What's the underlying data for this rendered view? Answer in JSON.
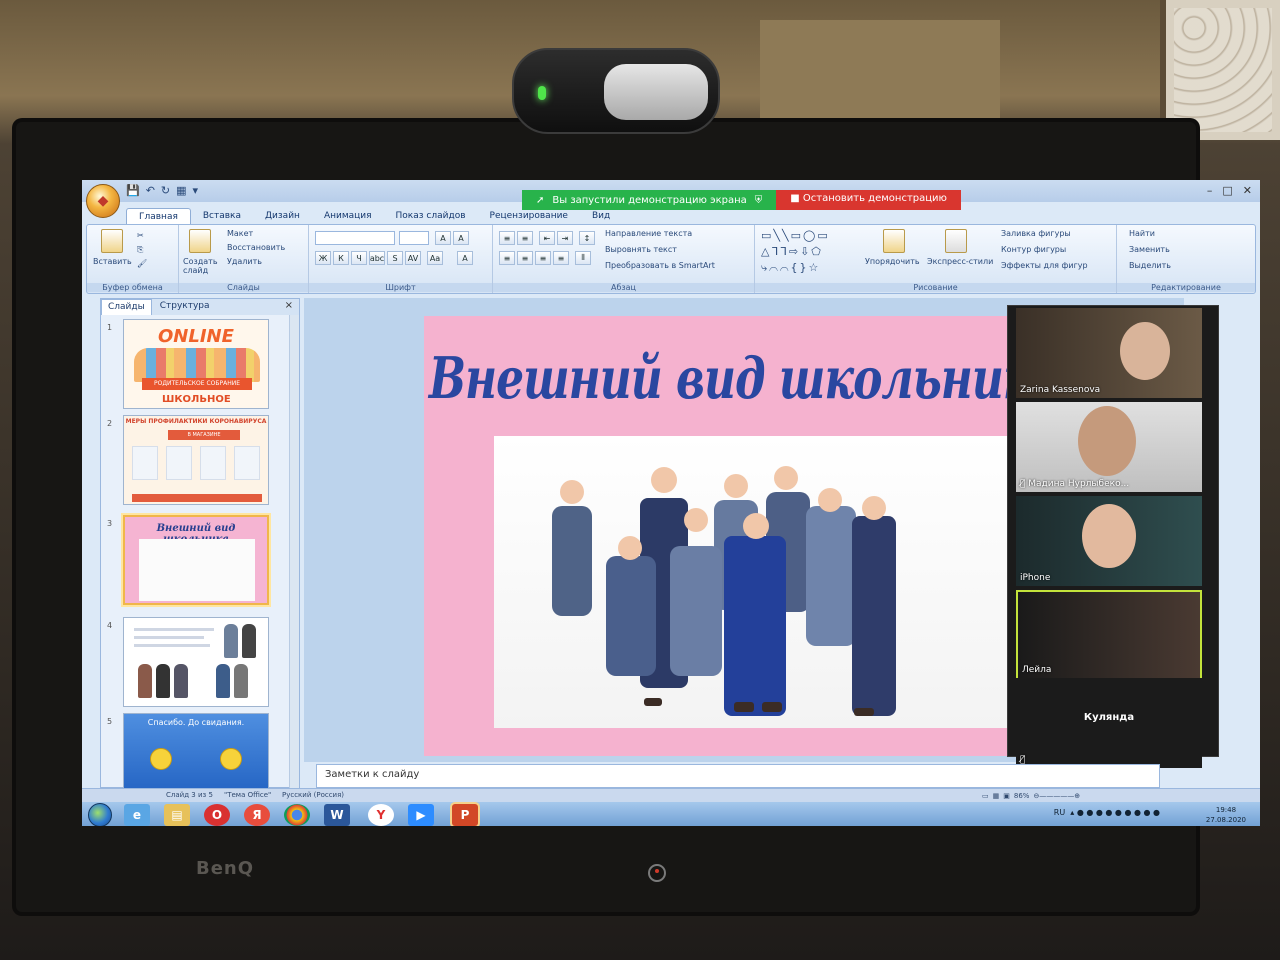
{
  "window": {
    "quick_access": [
      "💾",
      "↶",
      "↻",
      "▦",
      "▾"
    ],
    "controls": [
      "–",
      "□",
      "✕"
    ]
  },
  "share_bar": {
    "status": "Вы запустили демонстрацию экрана",
    "stop": "Остановить демонстрацию"
  },
  "ribbon": {
    "tabs": [
      "Главная",
      "Вставка",
      "Дизайн",
      "Анимация",
      "Показ слайдов",
      "Рецензирование",
      "Вид"
    ],
    "active_tab": "Главная",
    "clipboard": {
      "paste": "Вставить",
      "label": "Буфер обмена"
    },
    "slides": {
      "create": "Создать слайд",
      "layout": "Макет",
      "reset": "Восстановить",
      "delete": "Удалить",
      "label": "Слайды"
    },
    "font": {
      "label": "Шрифт",
      "bold": "Ж",
      "italic": "К",
      "underline": "Ч",
      "strike": "abc",
      "shadow": "S",
      "spacing": "AV",
      "case": "Aa",
      "grow": "A",
      "shrink": "A",
      "color": "A"
    },
    "paragraph": {
      "label": "Абзац",
      "direction": "Направление текста",
      "align": "Выровнять текст",
      "smartart": "Преобразовать в SmartArt"
    },
    "drawing": {
      "label": "Рисование",
      "arrange": "Упорядочить",
      "quick_styles": "Экспресс-стили",
      "fill": "Заливка фигуры",
      "outline": "Контур фигуры",
      "effects": "Эффекты для фигур"
    },
    "editing": {
      "label": "Редактирование",
      "find": "Найти",
      "replace": "Заменить",
      "select": "Выделить"
    }
  },
  "slides_pane": {
    "tabs": [
      "Слайды",
      "Структура"
    ],
    "close": "×",
    "thumbnails": [
      {
        "num": "1",
        "online": "ONLINE",
        "banner": "РОДИТЕЛЬСКОЕ СОБРАНИЕ",
        "subtitle": "ШКОЛЬНОЕ"
      },
      {
        "num": "2",
        "header": "МЕРЫ ПРОФИЛАКТИКИ КОРОНАВИРУСА",
        "sub": "В МАГАЗИНЕ"
      },
      {
        "num": "3",
        "title": "Внешний вид школьника"
      },
      {
        "num": "4"
      },
      {
        "num": "5",
        "text": "Спасибо. До свидания."
      }
    ],
    "selected_index": 2
  },
  "slide": {
    "title": "Внешний вид школьника"
  },
  "notes": {
    "placeholder": "Заметки к слайду"
  },
  "status": {
    "slide_info": "Слайд 3 из 5",
    "theme": "\"Тема Office\"",
    "language": "Русский (Россия)",
    "zoom": "86%"
  },
  "zoom_participants": [
    {
      "name": "Zarina Kassenova",
      "muted": false,
      "active": false
    },
    {
      "name": "Мадина Нурлыбеко...",
      "muted": true,
      "active": false
    },
    {
      "name": "iPhone",
      "muted": false,
      "active": false
    },
    {
      "name": "Лейла",
      "muted": false,
      "active": true
    },
    {
      "name": "Кулянда",
      "muted": true,
      "active": false
    }
  ],
  "taskbar": {
    "language": "RU",
    "time": "19:48",
    "date": "27.08.2020",
    "apps": [
      "Opera",
      "Яндекс",
      "Chrome",
      "Word",
      "Y",
      "Zoom",
      "PowerPoint"
    ]
  },
  "monitor": {
    "brand": "BenQ"
  },
  "colors": {
    "slide_bg": "#f5b2cf",
    "title_color": "#2a47a0",
    "share_green": "#28b34b",
    "share_red": "#d9362f",
    "active_speaker": "#c3e33b"
  }
}
